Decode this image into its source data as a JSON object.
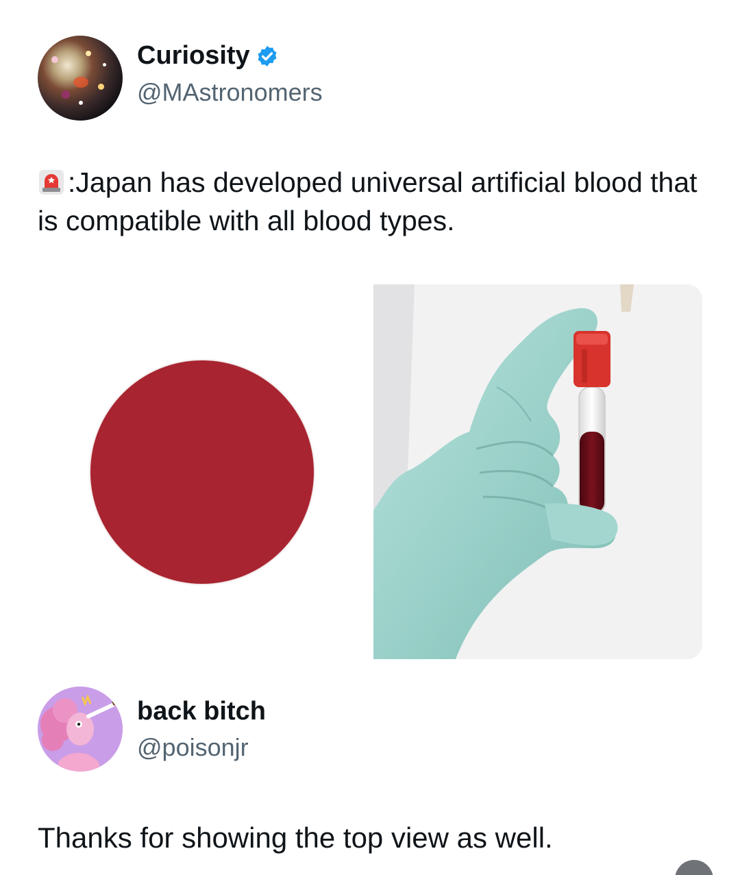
{
  "tweet1": {
    "display_name": "Curiosity",
    "handle": "@MAstronomers",
    "text": ":Japan has developed universal artificial blood that is compatible with all blood types.",
    "text_icon": "siren-icon",
    "verified": true,
    "verified_color": "#1d9bf0"
  },
  "tweet2": {
    "display_name": "back bitch",
    "handle": "@poisonjr",
    "text": "Thanks for showing the top view as well."
  },
  "media": {
    "left_image": "japan-flag-disc",
    "right_image": "gloved-hand-holding-blood-tube",
    "disc_color": "#a82430",
    "glove_color": "#9fd3cc",
    "cap_color": "#d8332c",
    "blood_color": "#6e0d16"
  }
}
